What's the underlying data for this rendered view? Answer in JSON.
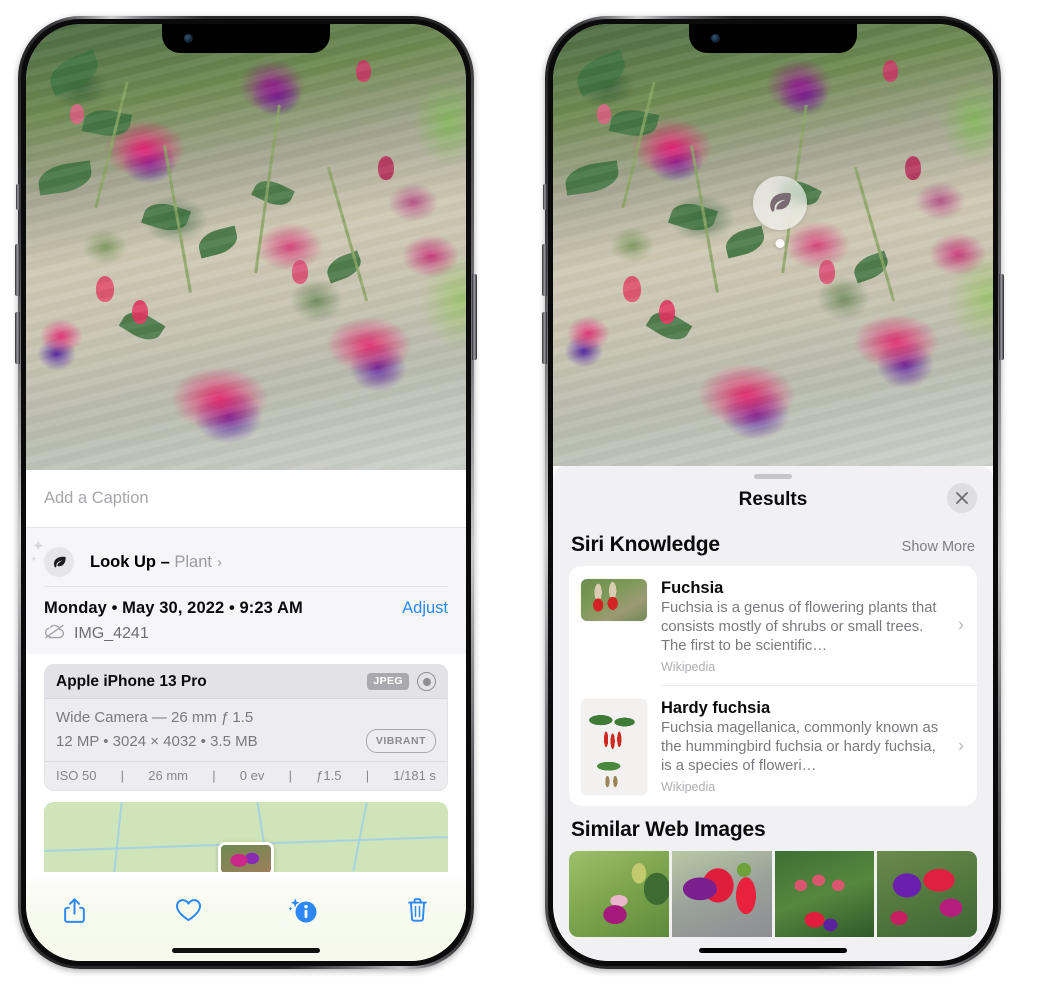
{
  "left_phone": {
    "caption": {
      "placeholder": "Add a Caption",
      "value": ""
    },
    "lookup": {
      "icon": "leaf-icon",
      "sparkle": "sparkle-icon",
      "label": "Look Up – ",
      "subject": "Plant",
      "chevron": "›"
    },
    "meta": {
      "date": "Monday • May 30, 2022 • 9:23 AM",
      "adjust_label": "Adjust",
      "cloud_icon": "icloud-slash-icon",
      "filename": "IMG_4241"
    },
    "exif": {
      "model": "Apple iPhone 13 Pro",
      "format_chip": "JPEG",
      "aperture_icon": "aperture-icon",
      "lens_line": "Wide Camera — 26 mm ƒ 1.5",
      "size_line": "12 MP • 3024 × 4032 • 3.5 MB",
      "style_chip": "VIBRANT",
      "stats": [
        "ISO 50",
        "26 mm",
        "0 ev",
        "ƒ1.5",
        "1/181 s"
      ]
    },
    "toolbar": [
      {
        "name": "share-icon",
        "label": "Share"
      },
      {
        "name": "heart-icon",
        "label": "Favorite"
      },
      {
        "name": "info-sparkle-icon",
        "label": "Info"
      },
      {
        "name": "trash-icon",
        "label": "Delete"
      }
    ]
  },
  "right_phone": {
    "badge": {
      "icon": "leaf-icon"
    },
    "sheet": {
      "grabber": "drag-handle",
      "title": "Results",
      "close_icon": "close-icon"
    },
    "siri_knowledge": {
      "section_title": "Siri Knowledge",
      "show_more": "Show More",
      "items": [
        {
          "title": "Fuchsia",
          "description": "Fuchsia is a genus of flowering plants that consists mostly of shrubs or small trees. The first to be scientific…",
          "source": "Wikipedia",
          "thumb": "fuchsia-red-flowers-thumb",
          "chevron": "›"
        },
        {
          "title": "Hardy fuchsia",
          "description": "Fuchsia magellanica, commonly known as the hummingbird fuchsia or hardy fuchsia, is a species of floweri…",
          "source": "Wikipedia",
          "thumb": "hardy-fuchsia-specimen-thumb",
          "chevron": "›"
        }
      ]
    },
    "similar_web_images": {
      "section_title": "Similar Web Images",
      "thumbs": [
        "fuchsia-pink-white-bloom",
        "fuchsia-red-closeup",
        "fuchsia-buds-bush",
        "fuchsia-purple-red-cluster"
      ]
    }
  },
  "colors": {
    "accent_blue": "#2b88f6",
    "sheet_gray": "#f1f1f4",
    "card_white": "#ffffff",
    "secondary_text": "#79797f"
  }
}
